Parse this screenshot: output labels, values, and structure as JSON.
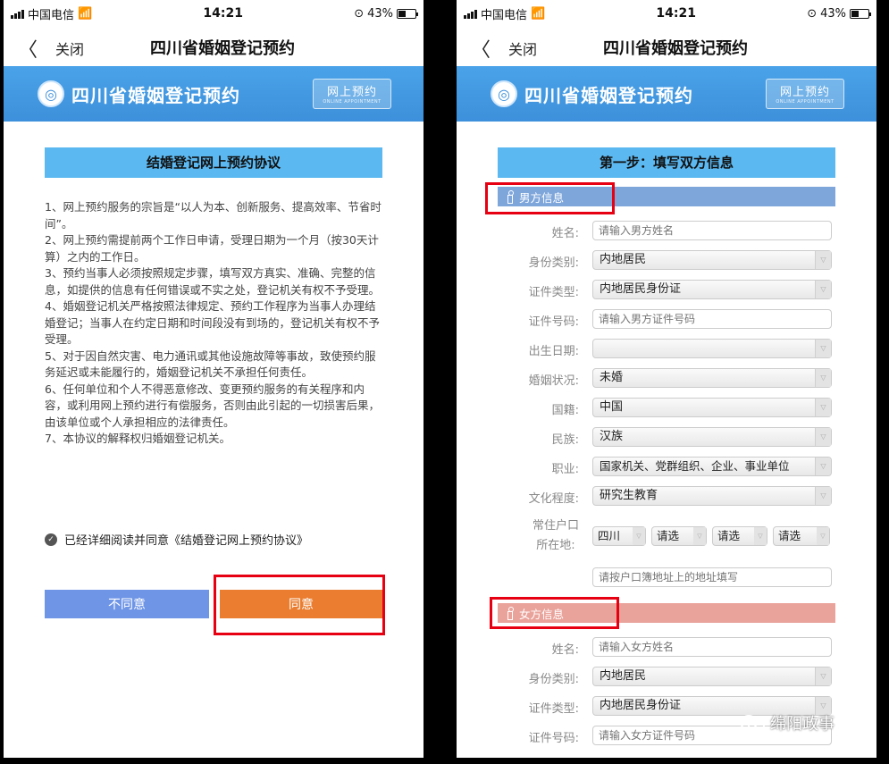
{
  "statusbar": {
    "carrier": "中国电信",
    "time": "14:21",
    "battery": "43%"
  },
  "nav": {
    "close_label": "关闭",
    "title": "四川省婚姻登记预约"
  },
  "banner": {
    "title": "四川省婚姻登记预约",
    "badge_main": "网上预约",
    "badge_sub": "ONLINE APPOINTMENT"
  },
  "agreement": {
    "title": "结婚登记网上预约协议",
    "lines": [
      "1、网上预约服务的宗旨是“以人为本、创新服务、提高效率、节省时间”。",
      "2、网上预约需提前两个工作日申请，受理日期为一个月（按30天计算）之内的工作日。",
      "3、预约当事人必须按照规定步骤，填写双方真实、准确、完整的信息，如提供的信息有任何错误或不实之处，登记机关有权不予受理。",
      "4、婚姻登记机关严格按照法律规定、预约工作程序为当事人办理结婚登记；当事人在约定日期和时间段没有到场的，登记机关有权不予受理。",
      "5、对于因自然灾害、电力通讯或其他设施故障等事故，致使预约服务延迟或未能履行的，婚姻登记机关不承担任何责任。",
      "6、任何单位和个人不得恶意修改、变更预约服务的有关程序和内容，或利用网上预约进行有偿服务，否则由此引起的一切损害后果，由该单位或个人承担相应的法律责任。",
      "7、本协议的解释权归婚姻登记机关。"
    ],
    "checkbox_label": "已经详细阅读并同意《结婚登记网上预约协议》",
    "disagree_label": "不同意",
    "agree_label": "同意"
  },
  "form": {
    "step_title": "第一步：填写双方信息",
    "male_header": "男方信息",
    "female_header": "女方信息",
    "labels": {
      "name": "姓名:",
      "id_category": "身份类别:",
      "cert_type": "证件类型:",
      "cert_number": "证件号码:",
      "birth_date": "出生日期:",
      "marital_status": "婚姻状况:",
      "nationality": "国籍:",
      "ethnicity": "民族:",
      "occupation": "职业:",
      "education": "文化程度:",
      "residence_line1": "常住户口",
      "residence_line2": "所在地:"
    },
    "male": {
      "name_placeholder": "请输入男方姓名",
      "id_category": "内地居民",
      "cert_type": "内地居民身份证",
      "cert_number_placeholder": "请输入男方证件号码",
      "birth_date": "",
      "marital_status": "未婚",
      "nationality": "中国",
      "ethnicity": "汉族",
      "occupation": "国家机关、党群组织、企业、事业单位",
      "education": "研究生教育",
      "residence_province": "四川",
      "residence_select2": "请选",
      "residence_select3": "请选",
      "residence_select4": "请选",
      "address_placeholder": "请按户口簿地址上的地址填写"
    },
    "female": {
      "name_placeholder": "请输入女方姓名",
      "id_category": "内地居民",
      "cert_type": "内地居民身份证",
      "cert_number_placeholder": "请输入女方证件号码"
    }
  },
  "watermark": "绵阳政事",
  "colors": {
    "banner": "#4aa3e8",
    "title_bar": "#5bb8f0",
    "male_bar": "#7ea6db",
    "female_bar": "#e9a39b",
    "agree": "#ea7d2f",
    "disagree": "#6f95e6",
    "highlight": "#e60012"
  }
}
